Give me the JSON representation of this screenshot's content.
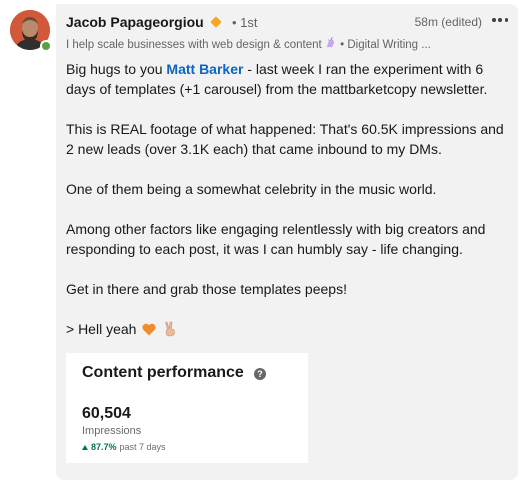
{
  "message": {
    "author": {
      "name": "Jacob Papageorgiou",
      "degree": "• 1st",
      "headline_prefix": "I help scale businesses with web design & content",
      "headline_suffix": "• Digital Writing ..."
    },
    "timestamp": "58m (edited)",
    "body": {
      "greeting_prefix": "Big hugs to you ",
      "mention": "Matt Barker",
      "greeting_suffix": " - last week I ran the experiment with 6 days of templates (+1 carousel) from the mattbarketcopy newsletter.",
      "p2": "This is REAL footage of what happened: That's 60.5K impressions and 2 new leads (over 3.1K each) that came inbound to my DMs.",
      "p3": "One of them being a somewhat celebrity in the music world.",
      "p4": "Among other factors like engaging relentlessly with big creators and responding to each post, it was I can humbly say - life changing.",
      "p5": "Get in there and grab those templates peeps!",
      "p6": "> Hell yeah"
    },
    "icons": {
      "premium": "premium-badge-icon",
      "more": "more-options-icon",
      "unicorn": "unicorn-icon",
      "heart": "orange-heart-icon",
      "peace": "peace-hand-icon",
      "help": "help-icon",
      "trend": "trend-up-arrow-icon"
    }
  },
  "content_performance": {
    "title": "Content performance",
    "value": "60,504",
    "label": "Impressions",
    "trend_pct": "87.7%",
    "trend_period": "past 7 days"
  },
  "colors": {
    "mention": "#0a66c2",
    "trend_up": "#057642",
    "presence": "#57a144",
    "bubble_bg": "#f2f2f2",
    "heart": "#f28c28"
  }
}
